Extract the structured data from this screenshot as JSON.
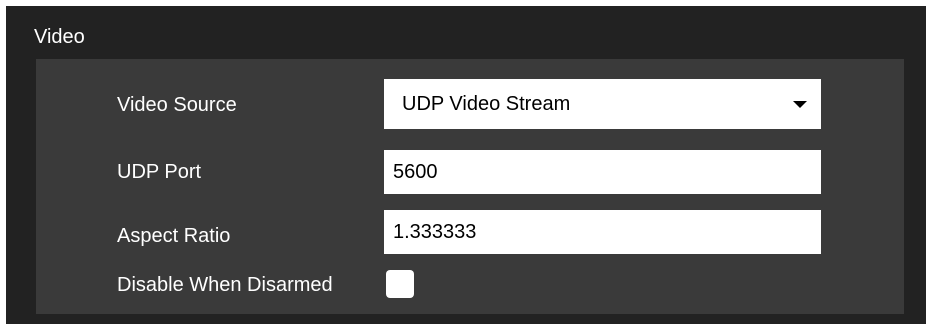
{
  "section": {
    "title": "Video"
  },
  "video_source": {
    "label": "Video Source",
    "selected": "UDP Video Stream",
    "arrow_icon": "caret-down-icon"
  },
  "udp_port": {
    "label": "UDP Port",
    "value": "5600"
  },
  "aspect_ratio": {
    "label": "Aspect Ratio",
    "value": "1.333333"
  },
  "disable_when_disarmed": {
    "label": "Disable When Disarmed",
    "checked": false
  },
  "colors": {
    "outer_background": "#222222",
    "panel_background": "#3a3a3a",
    "text": "#ffffff",
    "field_background": "#ffffff"
  }
}
